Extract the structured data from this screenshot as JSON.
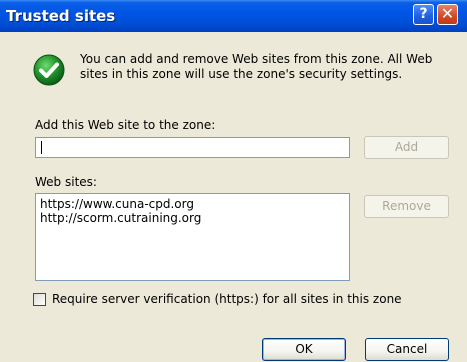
{
  "window": {
    "title": "Trusted sites",
    "help_button": "?",
    "close_button": "✕"
  },
  "info": {
    "icon": "green-checkmark-shield-icon",
    "text": "You can add and remove Web sites from this zone. All Web sites in this zone will use the zone's security settings."
  },
  "add_section": {
    "label": "Add this Web site to the zone:",
    "input_value": "",
    "add_button": "Add"
  },
  "sites_section": {
    "label": "Web sites:",
    "sites": [
      "https://www.cuna-cpd.org",
      "http://scorm.cutraining.org"
    ],
    "remove_button": "Remove"
  },
  "verification": {
    "label": "Require server verification (https:) for all sites in this zone",
    "checked": false
  },
  "footer": {
    "ok_button": "OK",
    "cancel_button": "Cancel"
  },
  "colors": {
    "title_bar": "#0055e5",
    "dialog_bg": "#ece9d8",
    "check_green": "#1e8f2a"
  }
}
